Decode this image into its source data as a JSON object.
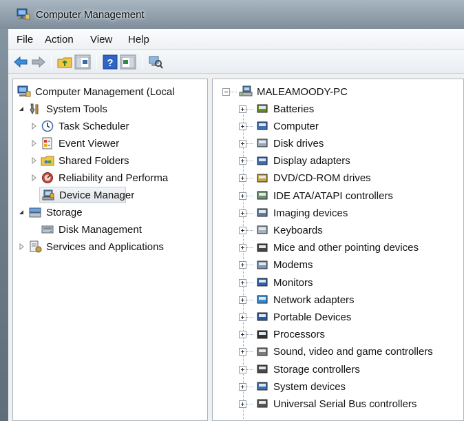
{
  "window": {
    "title": "Computer Management"
  },
  "menu": {
    "items": [
      "File",
      "Action",
      "View",
      "Help"
    ]
  },
  "toolbar": {
    "buttons": [
      "back-arrow-icon",
      "forward-arrow-icon",
      "up-folder-icon",
      "show-hide-console-tree-icon",
      "help-icon",
      "show-hide-action-pane-icon",
      "scan-hardware-icon"
    ]
  },
  "left_tree": {
    "root": "Computer Management (Local",
    "system_tools": "System Tools",
    "task_scheduler": "Task Scheduler",
    "event_viewer": "Event Viewer",
    "shared_folders": "Shared Folders",
    "reliability": "Reliability and Performa",
    "device_manager": "Device Manager",
    "storage": "Storage",
    "disk_management": "Disk Management",
    "services": "Services and Applications"
  },
  "device_tree": {
    "root": "MALEAMOODY-PC",
    "items": [
      "Batteries",
      "Computer",
      "Disk drives",
      "Display adapters",
      "DVD/CD-ROM drives",
      "IDE ATA/ATAPI controllers",
      "Imaging devices",
      "Keyboards",
      "Mice and other pointing devices",
      "Modems",
      "Monitors",
      "Network adapters",
      "Portable Devices",
      "Processors",
      "Sound, video and game controllers",
      "Storage controllers",
      "System devices",
      "Universal Serial Bus controllers"
    ]
  }
}
